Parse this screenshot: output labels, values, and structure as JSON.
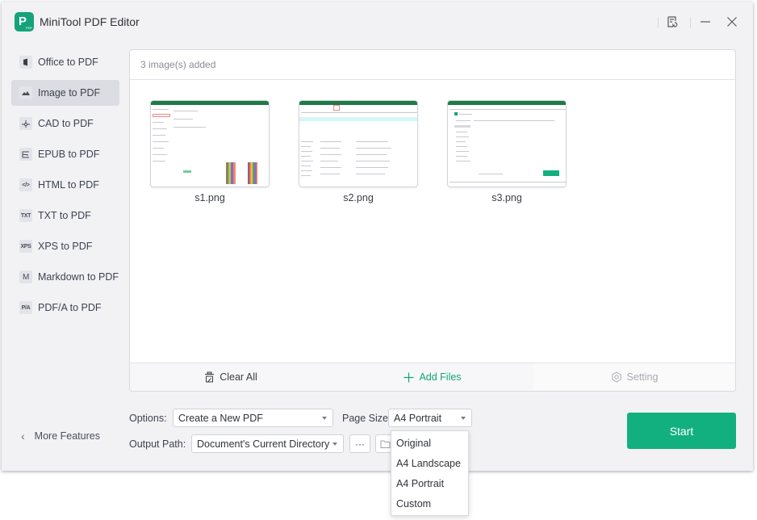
{
  "app": {
    "title": "MiniTool PDF Editor"
  },
  "titlebar": {
    "feedback_icon": "feedback-icon",
    "minimize_icon": "minimize-icon",
    "close_icon": "close-icon"
  },
  "sidebar": {
    "items": [
      {
        "label": "Office to PDF",
        "icon": "office-icon",
        "glyph": "▮",
        "active": false
      },
      {
        "label": "Image to PDF",
        "icon": "image-icon",
        "glyph": "⛰",
        "active": true
      },
      {
        "label": "CAD to PDF",
        "icon": "cad-icon",
        "glyph": "⊹",
        "active": false
      },
      {
        "label": "EPUB to PDF",
        "icon": "epub-icon",
        "glyph": "⊏",
        "active": false
      },
      {
        "label": "HTML to PDF",
        "icon": "html-icon",
        "glyph": "</>",
        "active": false
      },
      {
        "label": "TXT to PDF",
        "icon": "txt-icon",
        "glyph": "TXT",
        "active": false
      },
      {
        "label": "XPS to PDF",
        "icon": "xps-icon",
        "glyph": "XPS",
        "active": false
      },
      {
        "label": "Markdown to PDF",
        "icon": "markdown-icon",
        "glyph": "M",
        "active": false
      },
      {
        "label": "PDF/A to PDF",
        "icon": "pdfa-icon",
        "glyph": "P/A",
        "active": false
      }
    ],
    "more_features": "More Features"
  },
  "panel": {
    "header": "3 image(s) added",
    "files": [
      {
        "name": "s1.png"
      },
      {
        "name": "s2.png"
      },
      {
        "name": "s3.png"
      }
    ],
    "footer": {
      "clear_all": "Clear All",
      "add_files": "Add Files",
      "setting": "Setting"
    }
  },
  "options": {
    "options_label": "Options:",
    "options_value": "Create a New PDF",
    "page_size_label": "Page Size:",
    "page_size_value": "A4 Portrait",
    "output_path_label": "Output Path:",
    "output_path_value": "Document's Current Directory",
    "browse_label": "···",
    "page_size_options": [
      "Original",
      "A4 Landscape",
      "A4 Portrait",
      "Custom"
    ]
  },
  "start_button": "Start",
  "colors": {
    "accent": "#13b07f",
    "brand": "#14a37a"
  }
}
